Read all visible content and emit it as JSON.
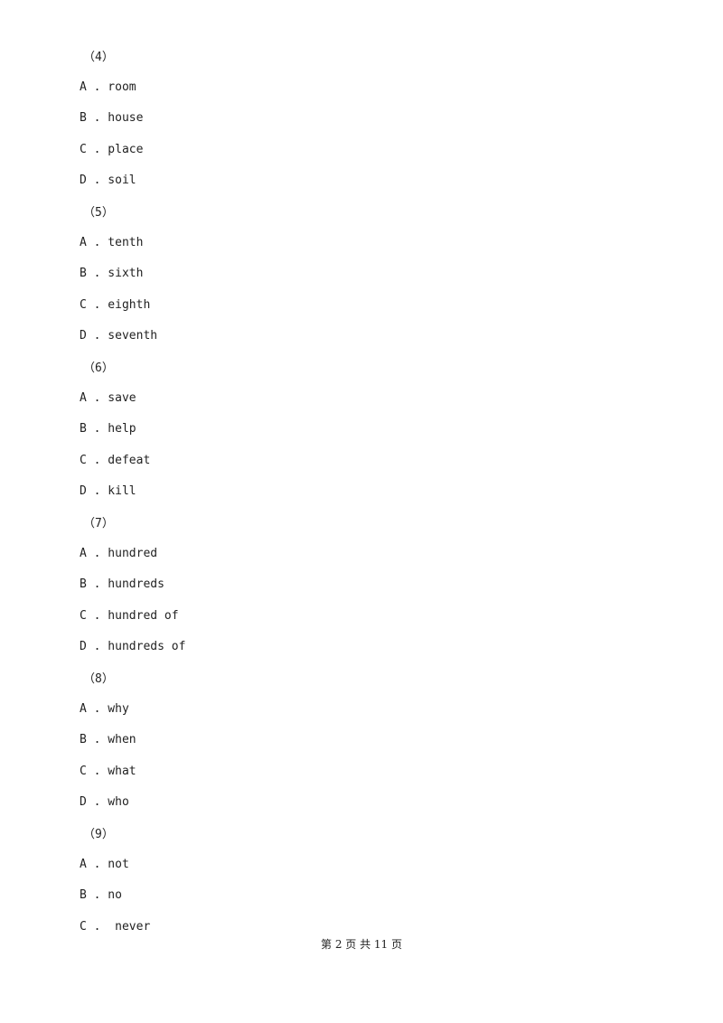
{
  "questions": [
    {
      "number": "（4）",
      "options": [
        "A . room",
        "B . house",
        "C . place",
        "D . soil"
      ]
    },
    {
      "number": "（5）",
      "options": [
        "A . tenth",
        "B . sixth",
        "C . eighth",
        "D . seventh"
      ]
    },
    {
      "number": "（6）",
      "options": [
        "A . save",
        "B . help",
        "C . defeat",
        "D . kill"
      ]
    },
    {
      "number": "（7）",
      "options": [
        "A . hundred",
        "B . hundreds",
        "C . hundred of",
        "D . hundreds of"
      ]
    },
    {
      "number": "（8）",
      "options": [
        "A . why",
        "B . when",
        "C . what",
        "D . who"
      ]
    },
    {
      "number": "（9）",
      "options": [
        "A . not",
        "B . no",
        "C .  never"
      ]
    }
  ],
  "footer": "第 2 页 共 11 页"
}
